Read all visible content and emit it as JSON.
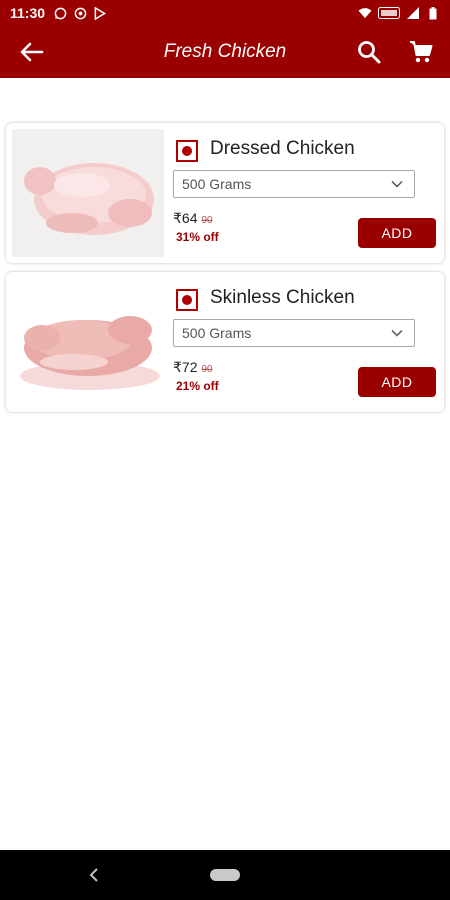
{
  "status_bar": {
    "time": "11:30",
    "left_icons": [
      "whatsapp-icon",
      "sync-icon",
      "play-store-icon"
    ],
    "right_icons": [
      "wifi-icon",
      "battery-saver-icon",
      "signal-icon",
      "battery-icon"
    ]
  },
  "app_bar": {
    "title": "Fresh Chicken",
    "back_icon": "arrow-left-icon",
    "search_icon": "search-icon",
    "cart_icon": "cart-icon"
  },
  "products": [
    {
      "name": "Dressed Chicken",
      "quantity": "500 Grams",
      "price": "₹64",
      "mrp": "90",
      "discount": "31% off",
      "add_label": "ADD"
    },
    {
      "name": "Skinless Chicken",
      "quantity": "500 Grams",
      "price": "₹72",
      "mrp": "90",
      "discount": "21% off",
      "add_label": "ADD"
    }
  ],
  "colors": {
    "primary": "#9b0000",
    "veg_mark": "#b00000",
    "discount": "#9b0000"
  }
}
